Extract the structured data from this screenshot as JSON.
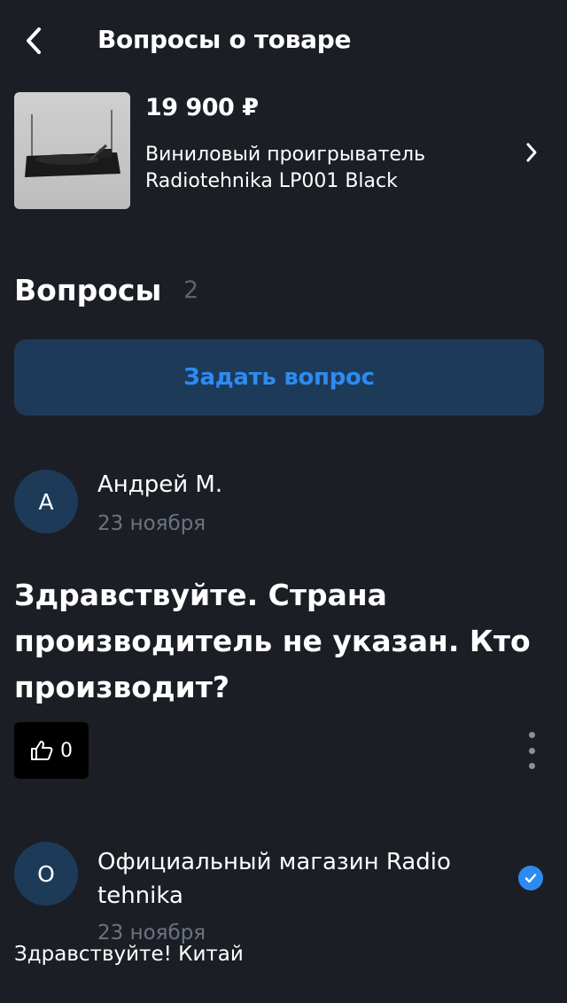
{
  "header": {
    "title": "Вопросы о товаре"
  },
  "product": {
    "price": "19 900 ₽",
    "name": "Виниловый проигрыватель Radiotehnika LP001 Black"
  },
  "questions_section": {
    "title": "Вопросы",
    "count": "2",
    "ask_button_label": "Задать вопрос"
  },
  "question": {
    "avatar_letter": "А",
    "author": "Андрей М.",
    "date": "23 ноября",
    "text": "Здравствуйте. Страна производитель не указан. Кто производит?",
    "likes": "0"
  },
  "answer": {
    "avatar_letter": "О",
    "author": "Официальный магазин Radio tehnika",
    "date": "23 ноября",
    "text": "Здравствуйте! Китай"
  },
  "colors": {
    "background": "#1b1e24",
    "accent": "#2d8bf0",
    "avatar_bg": "#1e3a59"
  }
}
